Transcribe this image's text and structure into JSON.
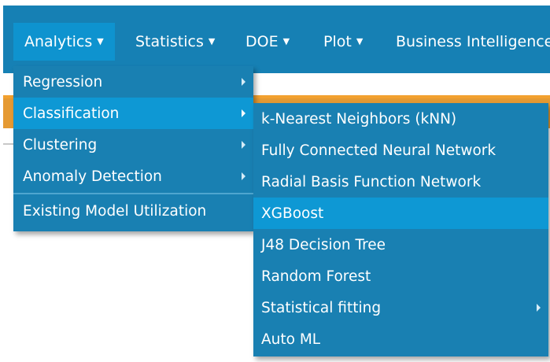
{
  "navbar": {
    "items": [
      {
        "label": "Analytics",
        "active": true
      },
      {
        "label": "Statistics"
      },
      {
        "label": "DOE"
      },
      {
        "label": "Plot"
      },
      {
        "label": "Business Intelligence"
      }
    ],
    "caret": "▼"
  },
  "analytics_menu": {
    "items": [
      {
        "label": "Regression",
        "has_submenu": true
      },
      {
        "label": "Classification",
        "has_submenu": true,
        "highlighted": true
      },
      {
        "label": "Clustering",
        "has_submenu": true
      },
      {
        "label": "Anomaly Detection",
        "has_submenu": true
      },
      {
        "label": "Existing Model Utilization",
        "has_submenu": false
      }
    ]
  },
  "classification_submenu": {
    "items": [
      {
        "label": "k-Nearest Neighbors (kNN)"
      },
      {
        "label": "Fully Connected Neural Network"
      },
      {
        "label": "Radial Basis Function Network"
      },
      {
        "label": "XGBoost",
        "hovered": true
      },
      {
        "label": "J48 Decision Tree"
      },
      {
        "label": "Random Forest"
      },
      {
        "label": "Statistical fitting",
        "has_submenu": true
      },
      {
        "label": "Auto ML"
      }
    ]
  },
  "colors": {
    "navbar": "#1680b4",
    "menu": "#1980b2",
    "highlight": "#0e98d4",
    "orange_band": "#f2a12f"
  }
}
